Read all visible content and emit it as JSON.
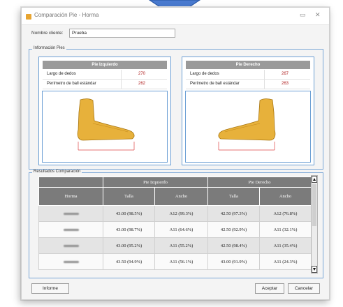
{
  "window": {
    "title": "Comparación Pie - Horma",
    "minimize": "▭",
    "close": "✕"
  },
  "client": {
    "label": "Nombre cliente:",
    "value": "Prueba"
  },
  "feet_group": {
    "title": "Información Pies",
    "left": {
      "header": "Pie Izquierdo",
      "rows": [
        {
          "label": "Largo de dedos",
          "value": "270"
        },
        {
          "label": "Perímetro de ball estándar",
          "value": "262"
        }
      ]
    },
    "right": {
      "header": "Pie Derecho",
      "rows": [
        {
          "label": "Largo de dedos",
          "value": "267"
        },
        {
          "label": "Perímetro de ball estándar",
          "value": "263"
        }
      ]
    }
  },
  "results": {
    "title": "Resultados Comparación",
    "group_headers": [
      "Pie Izquierdo",
      "Pie Derecho"
    ],
    "columns": [
      "Horma",
      "Talla",
      "Ancho",
      "Talla",
      "Ancho"
    ],
    "rows": [
      {
        "talla_l": "43.00 (98.5%)",
        "ancho_l": "A12 (99.3%)",
        "talla_r": "42.50 (97.3%)",
        "ancho_r": "A12 (76.8%)"
      },
      {
        "talla_l": "43.00 (98.7%)",
        "ancho_l": "A11 (64.6%)",
        "talla_r": "42.50 (92.9%)",
        "ancho_r": "A11 (32.1%)"
      },
      {
        "talla_l": "43.00 (95.2%)",
        "ancho_l": "A11 (55.2%)",
        "talla_r": "42.50 (98.4%)",
        "ancho_r": "A11 (35.4%)"
      },
      {
        "talla_l": "43.50 (94.9%)",
        "ancho_l": "A11 (56.1%)",
        "talla_r": "43.00 (91.9%)",
        "ancho_r": "A11 (24.3%)"
      }
    ]
  },
  "buttons": {
    "report": "Informe",
    "accept": "Aceptar",
    "cancel": "Cancelar"
  },
  "colors": {
    "accent_blue": "#4a7bd0",
    "value_red": "#b02020",
    "header_gray": "#7b7b7b",
    "foot_yellow": "#e7b13b"
  },
  "icons": [
    "arrow-down-icon",
    "app-icon",
    "scroll-up-icon",
    "scroll-down-icon",
    "foot-left-image",
    "foot-right-image"
  ]
}
